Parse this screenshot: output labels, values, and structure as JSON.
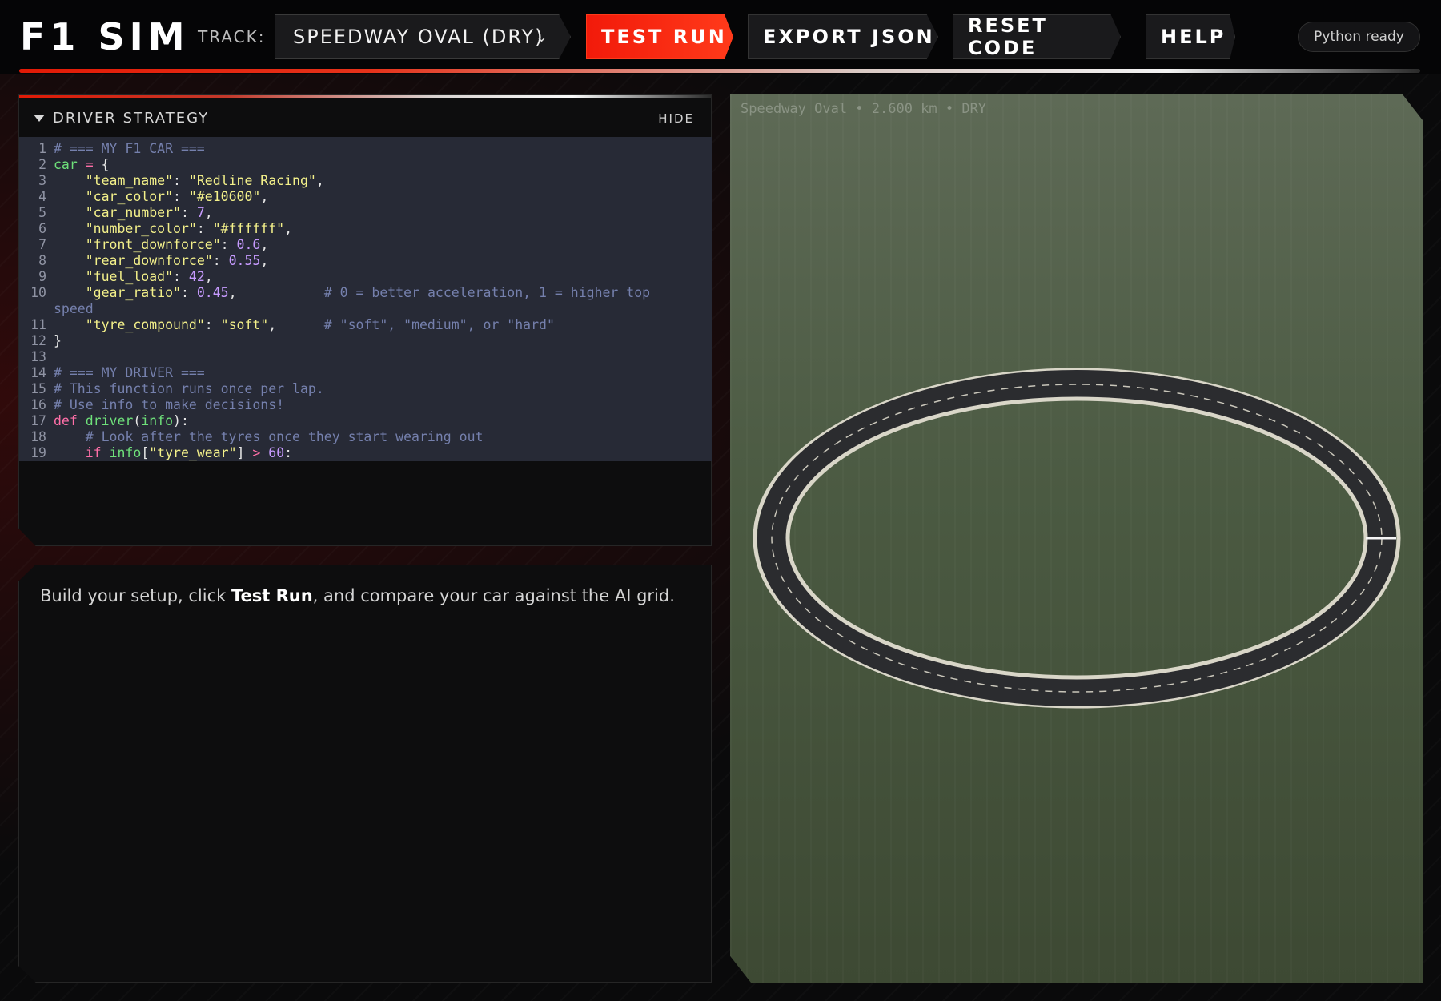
{
  "header": {
    "logo": "F1 SIM",
    "track_label": "TRACK:",
    "track_selected": "SPEEDWAY OVAL (DRY)",
    "buttons": {
      "test_run": "TEST RUN",
      "export_json": "EXPORT JSON",
      "reset_code": "RESET CODE",
      "help": "HELP"
    },
    "status": "Python ready"
  },
  "strategy_panel": {
    "title": "DRIVER STRATEGY",
    "hide_label": "HIDE",
    "code_lines": [
      {
        "n": "1",
        "tokens": [
          {
            "t": "# === MY F1 CAR ===",
            "c": "cmt"
          }
        ]
      },
      {
        "n": "2",
        "tokens": [
          {
            "t": "car",
            "c": "var"
          },
          {
            "t": " = ",
            "c": "op"
          },
          {
            "t": "{",
            "c": ""
          }
        ]
      },
      {
        "n": "3",
        "tokens": [
          {
            "t": "    \"team_name\"",
            "c": "str"
          },
          {
            "t": ": ",
            "c": ""
          },
          {
            "t": "\"Redline Racing\"",
            "c": "str"
          },
          {
            "t": ",",
            "c": ""
          }
        ]
      },
      {
        "n": "4",
        "tokens": [
          {
            "t": "    \"car_color\"",
            "c": "str"
          },
          {
            "t": ": ",
            "c": ""
          },
          {
            "t": "\"#e10600\"",
            "c": "str"
          },
          {
            "t": ",",
            "c": ""
          }
        ]
      },
      {
        "n": "5",
        "tokens": [
          {
            "t": "    \"car_number\"",
            "c": "str"
          },
          {
            "t": ": ",
            "c": ""
          },
          {
            "t": "7",
            "c": "num"
          },
          {
            "t": ",",
            "c": ""
          }
        ]
      },
      {
        "n": "6",
        "tokens": [
          {
            "t": "    \"number_color\"",
            "c": "str"
          },
          {
            "t": ": ",
            "c": ""
          },
          {
            "t": "\"#ffffff\"",
            "c": "str"
          },
          {
            "t": ",",
            "c": ""
          }
        ]
      },
      {
        "n": "7",
        "tokens": [
          {
            "t": "    \"front_downforce\"",
            "c": "str"
          },
          {
            "t": ": ",
            "c": ""
          },
          {
            "t": "0.6",
            "c": "num"
          },
          {
            "t": ",",
            "c": ""
          }
        ]
      },
      {
        "n": "8",
        "tokens": [
          {
            "t": "    \"rear_downforce\"",
            "c": "str"
          },
          {
            "t": ": ",
            "c": ""
          },
          {
            "t": "0.55",
            "c": "num"
          },
          {
            "t": ",",
            "c": ""
          }
        ]
      },
      {
        "n": "9",
        "tokens": [
          {
            "t": "    \"fuel_load\"",
            "c": "str"
          },
          {
            "t": ": ",
            "c": ""
          },
          {
            "t": "42",
            "c": "num"
          },
          {
            "t": ",",
            "c": ""
          }
        ]
      },
      {
        "n": "10",
        "tokens": [
          {
            "t": "    \"gear_ratio\"",
            "c": "str"
          },
          {
            "t": ": ",
            "c": ""
          },
          {
            "t": "0.45",
            "c": "num"
          },
          {
            "t": ",           ",
            "c": ""
          },
          {
            "t": "# 0 = better acceleration, 1 = higher top speed",
            "c": "cmt"
          }
        ]
      },
      {
        "n": "11",
        "tokens": [
          {
            "t": "    \"tyre_compound\"",
            "c": "str"
          },
          {
            "t": ": ",
            "c": ""
          },
          {
            "t": "\"soft\"",
            "c": "str"
          },
          {
            "t": ",      ",
            "c": ""
          },
          {
            "t": "# \"soft\", \"medium\", or \"hard\"",
            "c": "cmt"
          }
        ]
      },
      {
        "n": "12",
        "tokens": [
          {
            "t": "}",
            "c": ""
          }
        ]
      },
      {
        "n": "13",
        "tokens": [
          {
            "t": "",
            "c": ""
          }
        ]
      },
      {
        "n": "14",
        "tokens": [
          {
            "t": "# === MY DRIVER ===",
            "c": "cmt"
          }
        ]
      },
      {
        "n": "15",
        "tokens": [
          {
            "t": "# This function runs once per lap.",
            "c": "cmt"
          }
        ]
      },
      {
        "n": "16",
        "tokens": [
          {
            "t": "# Use info to make decisions!",
            "c": "cmt"
          }
        ]
      },
      {
        "n": "17",
        "tokens": [
          {
            "t": "def",
            "c": "kw"
          },
          {
            "t": " ",
            "c": ""
          },
          {
            "t": "driver",
            "c": "fn"
          },
          {
            "t": "(",
            "c": ""
          },
          {
            "t": "info",
            "c": "var"
          },
          {
            "t": "):",
            "c": ""
          }
        ]
      },
      {
        "n": "18",
        "tokens": [
          {
            "t": "    # Look after the tyres once they start wearing out",
            "c": "cmt"
          }
        ]
      },
      {
        "n": "19",
        "tokens": [
          {
            "t": "    ",
            "c": ""
          },
          {
            "t": "if",
            "c": "kw"
          },
          {
            "t": " ",
            "c": ""
          },
          {
            "t": "info",
            "c": "var"
          },
          {
            "t": "[",
            "c": ""
          },
          {
            "t": "\"tyre_wear\"",
            "c": "str"
          },
          {
            "t": "] ",
            "c": ""
          },
          {
            "t": ">",
            "c": "op"
          },
          {
            "t": " ",
            "c": ""
          },
          {
            "t": "60",
            "c": "num"
          },
          {
            "t": ":",
            "c": ""
          }
        ]
      }
    ]
  },
  "info_panel": {
    "text_before": "Build your setup, click ",
    "text_bold": "Test Run",
    "text_after": ", and compare your car against the AI grid."
  },
  "track_view": {
    "caption": "Speedway Oval • 2.600 km • DRY"
  },
  "colors": {
    "accent": "#f21a0a",
    "code_bg": "#272a36",
    "grass": "#4b5a42",
    "asphalt": "#2b2c2f"
  }
}
